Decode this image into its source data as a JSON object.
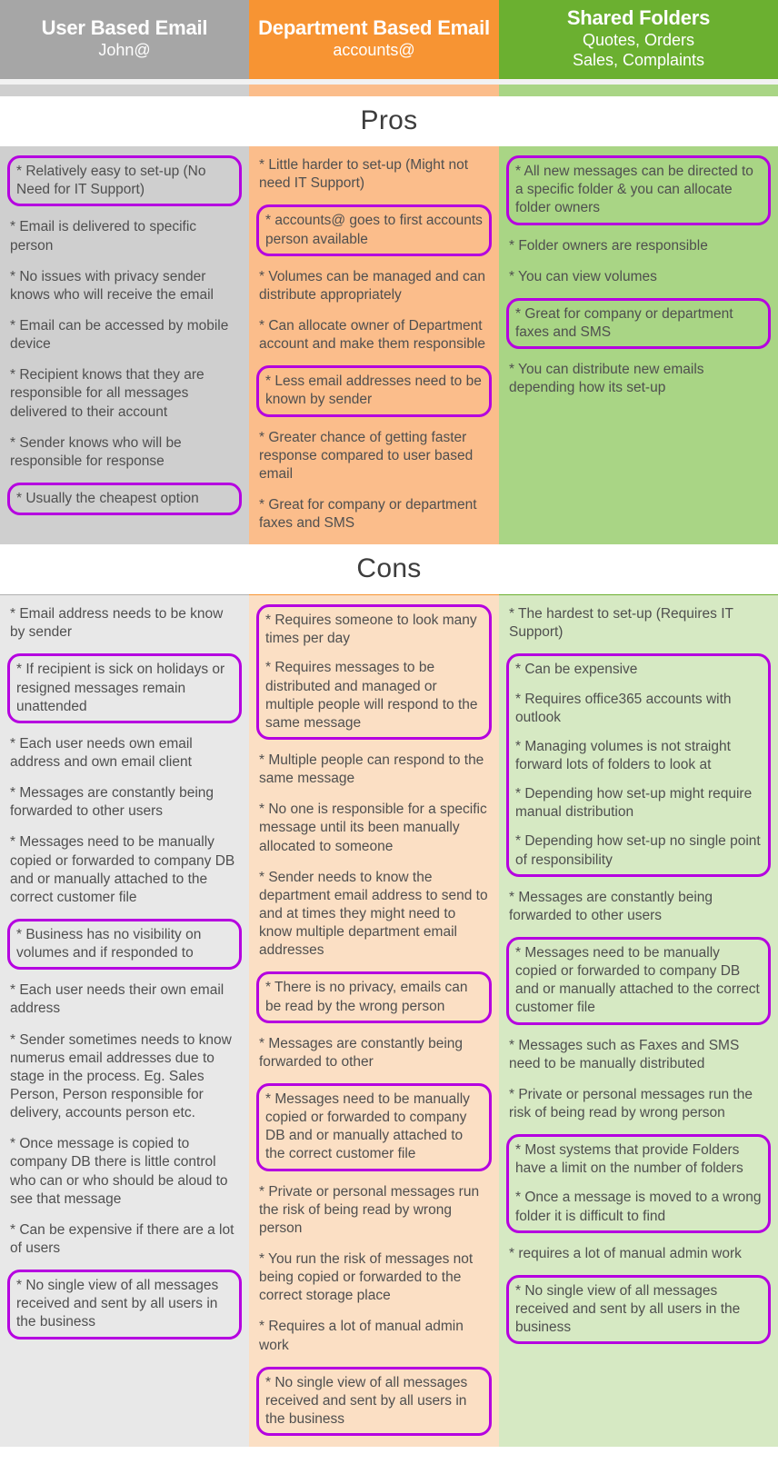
{
  "accent": {
    "highlight": "#b500e0",
    "grey": "#a6a6a6",
    "orange": "#f79433",
    "green": "#6bb030"
  },
  "columns": [
    {
      "title": "User Based Email",
      "subtitle": "John@"
    },
    {
      "title": "Department Based Email",
      "subtitle": "accounts@"
    },
    {
      "title": "Shared Folders",
      "subtitle": "Quotes, Orders\nSales, Complaints",
      "subtitle_line1": "Quotes, Orders",
      "subtitle_line2": "Sales, Complaints"
    }
  ],
  "sections": [
    {
      "heading": "Pros",
      "columns": [
        {
          "groups": [
            {
              "highlighted": true,
              "items": [
                "* Relatively easy to set-up (No Need for IT Support)"
              ]
            },
            {
              "highlighted": false,
              "items": [
                "* Email is delivered to specific person"
              ]
            },
            {
              "highlighted": false,
              "items": [
                "* No issues with privacy sender knows who will receive the email"
              ]
            },
            {
              "highlighted": false,
              "items": [
                "* Email can be accessed by mobile device"
              ]
            },
            {
              "highlighted": false,
              "items": [
                "* Recipient knows that they are responsible for all messages delivered to their account"
              ]
            },
            {
              "highlighted": false,
              "items": [
                "* Sender knows who will be responsible for response"
              ]
            },
            {
              "highlighted": true,
              "items": [
                "* Usually the cheapest option"
              ]
            }
          ]
        },
        {
          "groups": [
            {
              "highlighted": false,
              "items": [
                "* Little harder to set-up (Might not need IT Support)"
              ]
            },
            {
              "highlighted": true,
              "items": [
                "* accounts@ goes to first accounts person available"
              ]
            },
            {
              "highlighted": false,
              "items": [
                "* Volumes can be managed and can distribute appropriately"
              ]
            },
            {
              "highlighted": false,
              "items": [
                "* Can allocate owner of Department account and make them responsible"
              ]
            },
            {
              "highlighted": true,
              "items": [
                "* Less email addresses need to be known by sender"
              ]
            },
            {
              "highlighted": false,
              "items": [
                "* Greater chance of getting faster response compared to user based email"
              ]
            },
            {
              "highlighted": false,
              "items": [
                "* Great for company or department faxes and SMS"
              ]
            }
          ]
        },
        {
          "groups": [
            {
              "highlighted": true,
              "items": [
                "* All new messages can be directed to a specific folder & you can allocate folder owners"
              ]
            },
            {
              "highlighted": false,
              "items": [
                "* Folder owners are responsible"
              ]
            },
            {
              "highlighted": false,
              "items": [
                "* You can view volumes"
              ]
            },
            {
              "highlighted": true,
              "items": [
                "* Great for company or department faxes and SMS"
              ]
            },
            {
              "highlighted": false,
              "items": [
                "* You can distribute new emails depending how its set-up"
              ]
            }
          ]
        }
      ]
    },
    {
      "heading": "Cons",
      "columns": [
        {
          "groups": [
            {
              "highlighted": false,
              "items": [
                "* Email address needs to be know by sender"
              ]
            },
            {
              "highlighted": true,
              "items": [
                "* If recipient is sick on holidays or resigned messages remain unattended"
              ]
            },
            {
              "highlighted": false,
              "items": [
                "* Each user needs own email address and own email client"
              ]
            },
            {
              "highlighted": false,
              "items": [
                "* Messages are constantly being forwarded to other users"
              ]
            },
            {
              "highlighted": false,
              "items": [
                "* Messages need to be manually copied or forwarded to company DB and or manually attached to the correct customer file"
              ]
            },
            {
              "highlighted": true,
              "items": [
                "* Business has no visibility on volumes and if responded to"
              ]
            },
            {
              "highlighted": false,
              "items": [
                "* Each user needs their own email address"
              ]
            },
            {
              "highlighted": false,
              "items": [
                "* Sender sometimes needs to know numerus email addresses due to stage in the process. Eg. Sales Person, Person responsible for delivery, accounts person etc."
              ]
            },
            {
              "highlighted": false,
              "items": [
                "* Once message is copied to company DB there is little control who can or who should be aloud to see that message"
              ]
            },
            {
              "highlighted": false,
              "items": [
                "* Can be expensive if there are a lot of users"
              ]
            },
            {
              "highlighted": true,
              "items": [
                "* No single view of all messages received and sent by all users in the business"
              ]
            }
          ]
        },
        {
          "groups": [
            {
              "highlighted": true,
              "items": [
                "* Requires someone to look many times per day",
                "* Requires messages to be distributed and managed or multiple people will respond to the same message"
              ]
            },
            {
              "highlighted": false,
              "items": [
                "* Multiple people can respond to the same message"
              ]
            },
            {
              "highlighted": false,
              "items": [
                "* No one is responsible for a specific message until its been manually allocated to someone"
              ]
            },
            {
              "highlighted": false,
              "items": [
                "* Sender needs to know the department email address to send to and at times they might need to know multiple department email addresses"
              ]
            },
            {
              "highlighted": true,
              "items": [
                "* There is no privacy, emails can be read by the wrong person"
              ]
            },
            {
              "highlighted": false,
              "items": [
                "* Messages are constantly being forwarded to other"
              ]
            },
            {
              "highlighted": true,
              "items": [
                "* Messages need to be manually copied or forwarded to company DB and or manually attached to the correct customer file"
              ]
            },
            {
              "highlighted": false,
              "items": [
                "* Private or personal messages run the risk of being read by wrong person"
              ]
            },
            {
              "highlighted": false,
              "items": [
                "* You run the risk of messages not being copied or forwarded to the correct storage place"
              ]
            },
            {
              "highlighted": false,
              "items": [
                "* Requires a lot of manual admin work"
              ]
            },
            {
              "highlighted": true,
              "items": [
                "* No single view of all messages received and sent by all users in the business"
              ]
            }
          ]
        },
        {
          "groups": [
            {
              "highlighted": false,
              "items": [
                "* The hardest to set-up (Requires IT Support)"
              ]
            },
            {
              "highlighted": true,
              "items": [
                "* Can be expensive",
                "* Requires office365 accounts with outlook",
                "* Managing volumes is not straight forward lots of folders to look at",
                "* Depending how set-up might require manual distribution",
                "* Depending how set-up no single point of responsibility"
              ]
            },
            {
              "highlighted": false,
              "items": [
                "* Messages are constantly being forwarded to other users"
              ]
            },
            {
              "highlighted": true,
              "items": [
                "* Messages need to be manually copied or forwarded to company DB and or manually attached to the correct customer file"
              ]
            },
            {
              "highlighted": false,
              "items": [
                "* Messages such as Faxes and SMS need to be manually distributed"
              ]
            },
            {
              "highlighted": false,
              "items": [
                "* Private or personal messages run the risk of being read by wrong person"
              ]
            },
            {
              "highlighted": true,
              "items": [
                "* Most systems that provide Folders have a limit on the number of folders",
                "* Once a message is moved to a wrong folder it is difficult to find"
              ]
            },
            {
              "highlighted": false,
              "items": [
                "* requires a lot of manual admin work"
              ]
            },
            {
              "highlighted": true,
              "items": [
                "* No single view of all messages received and sent by all users in the business"
              ]
            }
          ]
        }
      ]
    }
  ]
}
